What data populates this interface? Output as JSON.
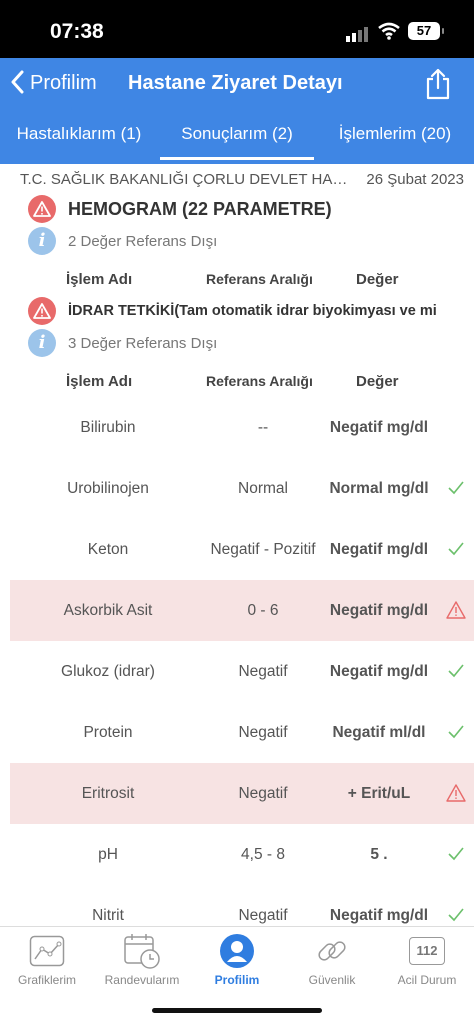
{
  "status_bar": {
    "time": "07:38",
    "battery": "57"
  },
  "nav": {
    "back_label": "Profilim",
    "title": "Hastane Ziyaret Detayı"
  },
  "tabs": [
    {
      "label": "Hastalıklarım (1)"
    },
    {
      "label": "Sonuçlarım (2)"
    },
    {
      "label": "İşlemlerim (20)"
    }
  ],
  "visit": {
    "hospital": "T.C. SAĞLIK BAKANLIĞI ÇORLU DEVLET HASTANESİ",
    "date": "26 Şubat 2023"
  },
  "groups": [
    {
      "title": "HEMOGRAM (22 PARAMETRE)",
      "info": "2 Değer Referans Dışı",
      "headers": {
        "name": "İşlem Adı",
        "range": "Referans Aralığı",
        "value": "Değer"
      }
    },
    {
      "title": "İDRAR TETKİKİ(Tam otomatik idrar biyokimyası ve mi",
      "info": "3 Değer Referans Dışı",
      "headers": {
        "name": "İşlem Adı",
        "range": "Referans Aralığı",
        "value": "Değer"
      }
    }
  ],
  "results": [
    {
      "name": "Bilirubin",
      "range": "--",
      "value": "Negatif mg/dl",
      "status": "none"
    },
    {
      "name": "Urobilinojen",
      "range": "Normal",
      "value": "Normal mg/dl",
      "status": "ok"
    },
    {
      "name": "Keton",
      "range": "Negatif - Pozitif",
      "value": "Negatif mg/dl",
      "status": "ok"
    },
    {
      "name": "Askorbik Asit",
      "range": "0 - 6",
      "value": "Negatif mg/dl",
      "status": "warn"
    },
    {
      "name": "Glukoz (idrar)",
      "range": "Negatif",
      "value": "Negatif mg/dl",
      "status": "ok"
    },
    {
      "name": "Protein",
      "range": "Negatif",
      "value": "Negatif ml/dl",
      "status": "ok"
    },
    {
      "name": "Eritrosit",
      "range": "Negatif",
      "value": "+ Erit/uL",
      "status": "warn"
    },
    {
      "name": "pH",
      "range": "4,5 - 8",
      "value": "5 .",
      "status": "ok"
    },
    {
      "name": "Nitrit",
      "range": "Negatif",
      "value": "Negatif mg/dl",
      "status": "ok"
    }
  ],
  "bottom_tabs": [
    {
      "label": "Grafiklerim",
      "icon": "chart-icon"
    },
    {
      "label": "Randevularım",
      "icon": "calendar-clock-icon"
    },
    {
      "label": "Profilim",
      "icon": "profile-icon"
    },
    {
      "label": "Güvenlik",
      "icon": "link-icon"
    },
    {
      "label": "Acil Durum",
      "icon": "emergency-112-icon",
      "badge": "112"
    }
  ],
  "colors": {
    "primary": "#3f86e4",
    "warning": "#e86a6a",
    "ok": "#6cc06c",
    "alert_row": "#f7e3e3",
    "active_tab": "#2f7de0"
  }
}
